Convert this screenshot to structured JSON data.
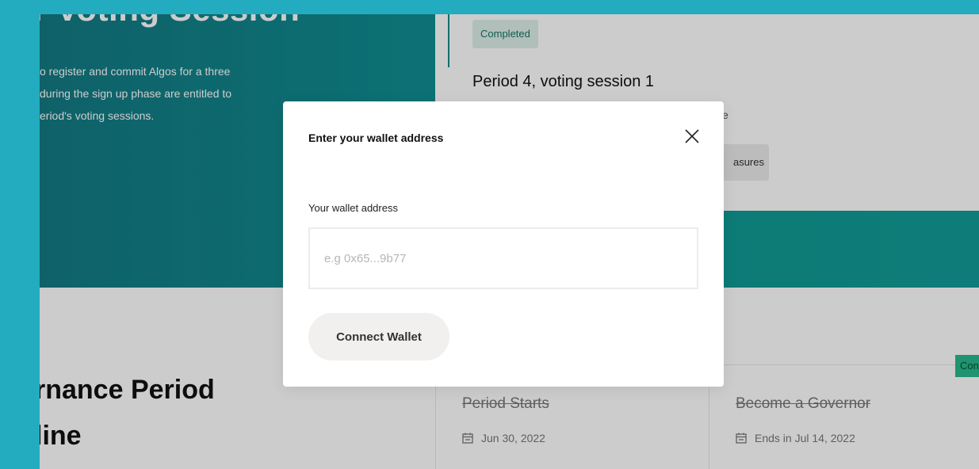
{
  "hero": {
    "title": "r Voting Session",
    "lines": [
      "o register and commit Algos for a three",
      " during the sign up phase are entitled to",
      "eriod's voting sessions."
    ]
  },
  "session": {
    "status": "Completed",
    "title": "Period 4, voting session 1",
    "desc_fragment": "ce",
    "measures_fragment": "asures"
  },
  "timeline": {
    "title_lines": [
      "rnance Period",
      "line"
    ],
    "items": [
      {
        "name": "Period Starts",
        "date": "Jun 30, 2022"
      },
      {
        "name": "Become a Governor",
        "date": "Ends in Jul 14, 2022"
      }
    ],
    "badge_fragment": "Con"
  },
  "modal": {
    "title": "Enter your wallet address",
    "field_label": "Your wallet address",
    "input_value": "",
    "input_placeholder": "e.g 0x65...9b77",
    "connect_label": "Connect Wallet"
  },
  "colors": {
    "page_background": "#2cd8ef",
    "hero_teal": "#137a83",
    "badge_bg": "#dcefe9",
    "badge_text": "#157364"
  }
}
